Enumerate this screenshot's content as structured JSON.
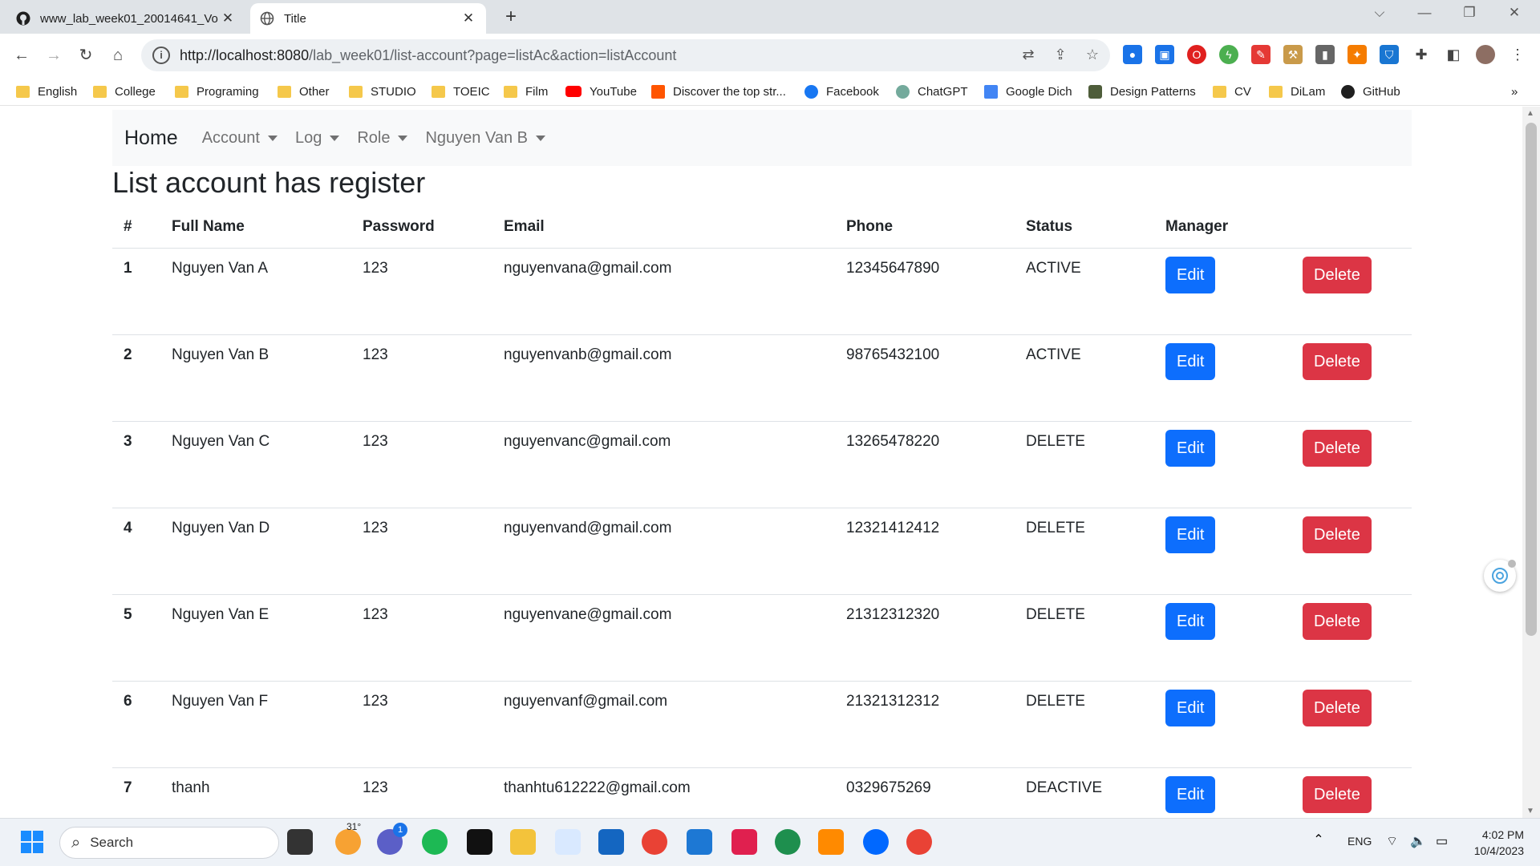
{
  "browser": {
    "tabs": [
      {
        "title": "www_lab_week01_20014641_Vo",
        "active": false
      },
      {
        "title": "Title",
        "active": true
      }
    ],
    "url_host": "http://localhost:8080",
    "url_path": "/lab_week01/list-account?page=listAc&action=listAccount",
    "bookmarks": [
      "English",
      "College",
      "Programing",
      "Other",
      "STUDIO",
      "TOEIC",
      "Film",
      "YouTube",
      "Discover the top str...",
      "Facebook",
      "ChatGPT",
      "Google Dich",
      "Design Patterns",
      "CV",
      "DiLam",
      "GitHub"
    ],
    "more_bookmarks": "»"
  },
  "navbar": {
    "brand": "Home",
    "items": [
      "Account",
      "Log",
      "Role",
      "Nguyen Van B"
    ]
  },
  "page": {
    "title": "List account has register"
  },
  "table": {
    "headers": {
      "num": "#",
      "fullname": "Full Name",
      "password": "Password",
      "email": "Email",
      "phone": "Phone",
      "status": "Status",
      "manager": "Manager"
    },
    "rows": [
      {
        "num": "1",
        "fullname": "Nguyen Van A",
        "password": "123",
        "email": "nguyenvana@gmail.com",
        "phone": "12345647890",
        "status": "ACTIVE"
      },
      {
        "num": "2",
        "fullname": "Nguyen Van B",
        "password": "123",
        "email": "nguyenvanb@gmail.com",
        "phone": "98765432100",
        "status": "ACTIVE"
      },
      {
        "num": "3",
        "fullname": "Nguyen Van C",
        "password": "123",
        "email": "nguyenvanc@gmail.com",
        "phone": "13265478220",
        "status": "DELETE"
      },
      {
        "num": "4",
        "fullname": "Nguyen Van D",
        "password": "123",
        "email": "nguyenvand@gmail.com",
        "phone": "12321412412",
        "status": "DELETE"
      },
      {
        "num": "5",
        "fullname": "Nguyen Van E",
        "password": "123",
        "email": "nguyenvane@gmail.com",
        "phone": "21312312320",
        "status": "DELETE"
      },
      {
        "num": "6",
        "fullname": "Nguyen Van F",
        "password": "123",
        "email": "nguyenvanf@gmail.com",
        "phone": "21321312312",
        "status": "DELETE"
      },
      {
        "num": "7",
        "fullname": "thanh",
        "password": "123",
        "email": "thanhtu612222@gmail.com",
        "phone": "0329675269",
        "status": "DEACTIVE"
      }
    ],
    "edit_label": "Edit",
    "delete_label": "Delete"
  },
  "taskbar": {
    "search_placeholder": "Search",
    "weather": "31°",
    "chat_badge": "1",
    "language": "ENG",
    "time": "4:02 PM",
    "date": "10/4/2023"
  },
  "colors": {
    "primary": "#0d6efd",
    "danger": "#dc3545",
    "navbar_bg": "#f8f9fa"
  }
}
